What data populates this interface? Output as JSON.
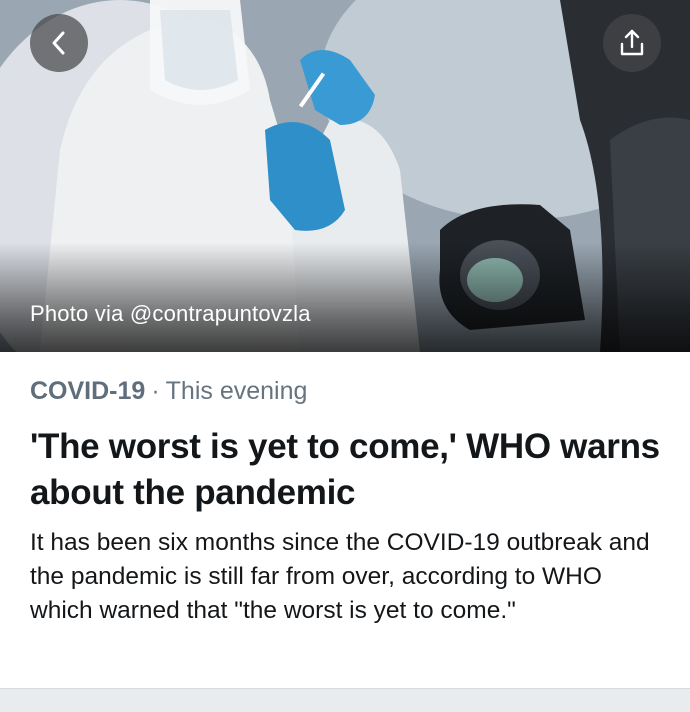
{
  "hero": {
    "photo_credit": "Photo via @contrapuntovzla",
    "back_icon": "chevron-left-icon",
    "share_icon": "share-upload-icon"
  },
  "article": {
    "topic": "COVID-19",
    "separator": "·",
    "time": "This evening",
    "headline": "'The worst is yet to come,' WHO warns about the pandemic",
    "summary": "It has been six months since the COVID-19 outbreak and the pandemic is still far from over, according to WHO which warned that \"the worst is yet to come.\""
  },
  "colors": {
    "meta_text": "#667480",
    "body_text": "#14171a",
    "button_bg": "#46464a"
  }
}
